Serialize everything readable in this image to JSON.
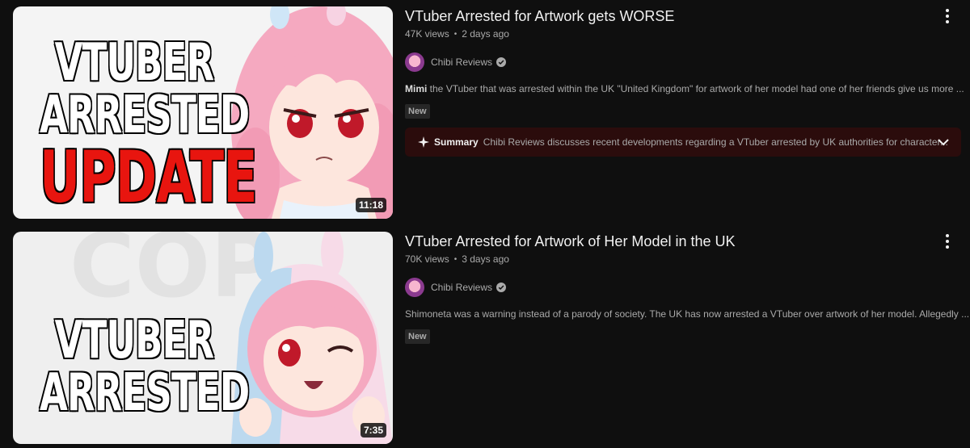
{
  "videos": [
    {
      "title": "VTuber Arrested for Artwork gets WORSE",
      "views": "47K views",
      "age": "2 days ago",
      "channel": "Chibi Reviews",
      "description_lead": "Mimi",
      "description_rest": " the VTuber that was arrested within the UK \"United Kingdom\" for artwork of her model had one of her friends give us more ...",
      "badge": "New",
      "duration": "11:18",
      "thumb_lines": [
        "VTUBER",
        "ARRESTED",
        "UPDATE"
      ],
      "summary_label": "Summary",
      "summary_text": "Chibi Reviews discusses recent developments regarding a VTuber arrested by UK authorities for character..."
    },
    {
      "title": "VTuber Arrested for Artwork of Her Model in the UK",
      "views": "70K views",
      "age": "3 days ago",
      "channel": "Chibi Reviews",
      "description": "Shimoneta was a warning instead of a parody of society. The UK has now arrested a VTuber over artwork of her model. Allegedly ...",
      "badge": "New",
      "duration": "7:35",
      "thumb_lines": [
        "VTUBER",
        "ARRESTED"
      ]
    }
  ],
  "icons": {
    "more": "more-vert-icon",
    "verified": "verified-check-icon",
    "sparkle": "sparkle-icon",
    "chevron": "chevron-down-icon"
  },
  "colors": {
    "background": "#0f0f0f",
    "summary_bg": "#2b0c0c",
    "update_red": "#e8150f",
    "hair_pink": "#f5a9c0"
  }
}
